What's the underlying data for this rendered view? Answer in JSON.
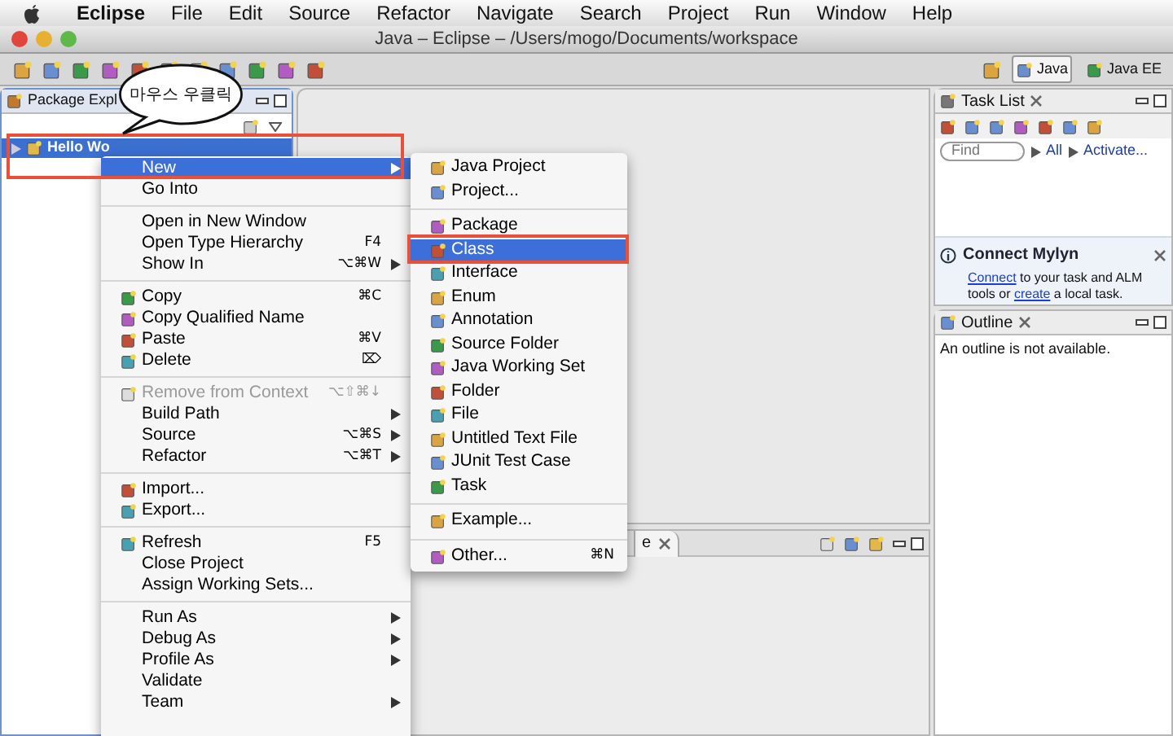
{
  "menubar": {
    "app": "Eclipse",
    "items": [
      "File",
      "Edit",
      "Source",
      "Refactor",
      "Navigate",
      "Search",
      "Project",
      "Run",
      "Window",
      "Help"
    ]
  },
  "window": {
    "title": "Java – Eclipse – /Users/mogo/Documents/workspace"
  },
  "perspectives": [
    {
      "label": "Java",
      "selected": true
    },
    {
      "label": "Java EE",
      "selected": false
    }
  ],
  "package_explorer": {
    "title": "Package Expl",
    "tree": [
      {
        "label": "Hello Wo",
        "selected": true
      }
    ]
  },
  "callout": {
    "text": "마우스 우클릭"
  },
  "context_menu": {
    "groups": [
      {
        "items": [
          {
            "label": "New",
            "submenu": true,
            "selected": true,
            "disabled": false,
            "icon": false
          },
          {
            "label": "Go Into",
            "submenu": false,
            "selected": false,
            "disabled": false,
            "icon": false
          }
        ]
      },
      {
        "items": [
          {
            "label": "Open in New Window",
            "submenu": false,
            "selected": false,
            "disabled": false,
            "icon": false
          },
          {
            "label": "Open Type Hierarchy",
            "shortcut": "F4",
            "submenu": false,
            "selected": false,
            "disabled": false,
            "icon": false
          },
          {
            "label": "Show In",
            "shortcut": "⌥⌘W",
            "submenu": true,
            "selected": false,
            "disabled": false,
            "icon": false
          }
        ]
      },
      {
        "items": [
          {
            "label": "Copy",
            "shortcut": "⌘C",
            "submenu": false,
            "selected": false,
            "disabled": false,
            "icon": true
          },
          {
            "label": "Copy Qualified Name",
            "submenu": false,
            "selected": false,
            "disabled": false,
            "icon": true
          },
          {
            "label": "Paste",
            "shortcut": "⌘V",
            "submenu": false,
            "selected": false,
            "disabled": false,
            "icon": true
          },
          {
            "label": "Delete",
            "shortcut": "⌦",
            "submenu": false,
            "selected": false,
            "disabled": false,
            "icon": true
          }
        ]
      },
      {
        "items": [
          {
            "label": "Remove from Context",
            "shortcut": "⌥⇧⌘↓",
            "submenu": false,
            "selected": false,
            "disabled": true,
            "icon": true
          },
          {
            "label": "Build Path",
            "submenu": true,
            "selected": false,
            "disabled": false,
            "icon": false
          },
          {
            "label": "Source",
            "shortcut": "⌥⌘S",
            "submenu": true,
            "selected": false,
            "disabled": false,
            "icon": false
          },
          {
            "label": "Refactor",
            "shortcut": "⌥⌘T",
            "submenu": true,
            "selected": false,
            "disabled": false,
            "icon": false
          }
        ]
      },
      {
        "items": [
          {
            "label": "Import...",
            "submenu": false,
            "selected": false,
            "disabled": false,
            "icon": true
          },
          {
            "label": "Export...",
            "submenu": false,
            "selected": false,
            "disabled": false,
            "icon": true
          }
        ]
      },
      {
        "items": [
          {
            "label": "Refresh",
            "shortcut": "F5",
            "submenu": false,
            "selected": false,
            "disabled": false,
            "icon": true
          },
          {
            "label": "Close Project",
            "submenu": false,
            "selected": false,
            "disabled": false,
            "icon": false
          },
          {
            "label": "Assign Working Sets...",
            "submenu": false,
            "selected": false,
            "disabled": false,
            "icon": false
          }
        ]
      },
      {
        "items": [
          {
            "label": "Run As",
            "submenu": true,
            "selected": false,
            "disabled": false,
            "icon": false
          },
          {
            "label": "Debug As",
            "submenu": true,
            "selected": false,
            "disabled": false,
            "icon": false
          },
          {
            "label": "Profile As",
            "submenu": true,
            "selected": false,
            "disabled": false,
            "icon": false
          },
          {
            "label": "Validate",
            "submenu": false,
            "selected": false,
            "disabled": false,
            "icon": false
          },
          {
            "label": "Team",
            "submenu": true,
            "selected": false,
            "disabled": false,
            "icon": false
          }
        ]
      }
    ]
  },
  "submenu": {
    "groups": [
      {
        "items": [
          {
            "label": "Java Project",
            "selected": false
          },
          {
            "label": "Project...",
            "selected": false
          }
        ]
      },
      {
        "items": [
          {
            "label": "Package",
            "selected": false
          },
          {
            "label": "Class",
            "selected": true
          },
          {
            "label": "Interface",
            "selected": false
          },
          {
            "label": "Enum",
            "selected": false
          },
          {
            "label": "Annotation",
            "selected": false
          },
          {
            "label": "Source Folder",
            "selected": false
          },
          {
            "label": "Java Working Set",
            "selected": false
          },
          {
            "label": "Folder",
            "selected": false
          },
          {
            "label": "File",
            "selected": false
          },
          {
            "label": "Untitled Text File",
            "selected": false
          },
          {
            "label": "JUnit Test Case",
            "selected": false
          },
          {
            "label": "Task",
            "selected": false
          }
        ]
      },
      {
        "items": [
          {
            "label": "Example...",
            "selected": false
          }
        ]
      },
      {
        "items": [
          {
            "label": "Other...",
            "shortcut": "⌘N",
            "selected": false
          }
        ]
      }
    ]
  },
  "task_list": {
    "title": "Task List",
    "find_placeholder": "Find",
    "filters": [
      "All",
      "Activate..."
    ],
    "mylyn": {
      "title": "Connect Mylyn",
      "text": [
        {
          "text": "Connect",
          "link": true
        },
        {
          "text": " to your task and ALM tools or ",
          "link": false
        },
        {
          "text": "create",
          "link": true
        },
        {
          "text": " a local task.",
          "link": false
        }
      ]
    }
  },
  "outline": {
    "title": "Outline",
    "message": "An outline is not available."
  },
  "bottom_panel": {
    "tab": "e"
  }
}
